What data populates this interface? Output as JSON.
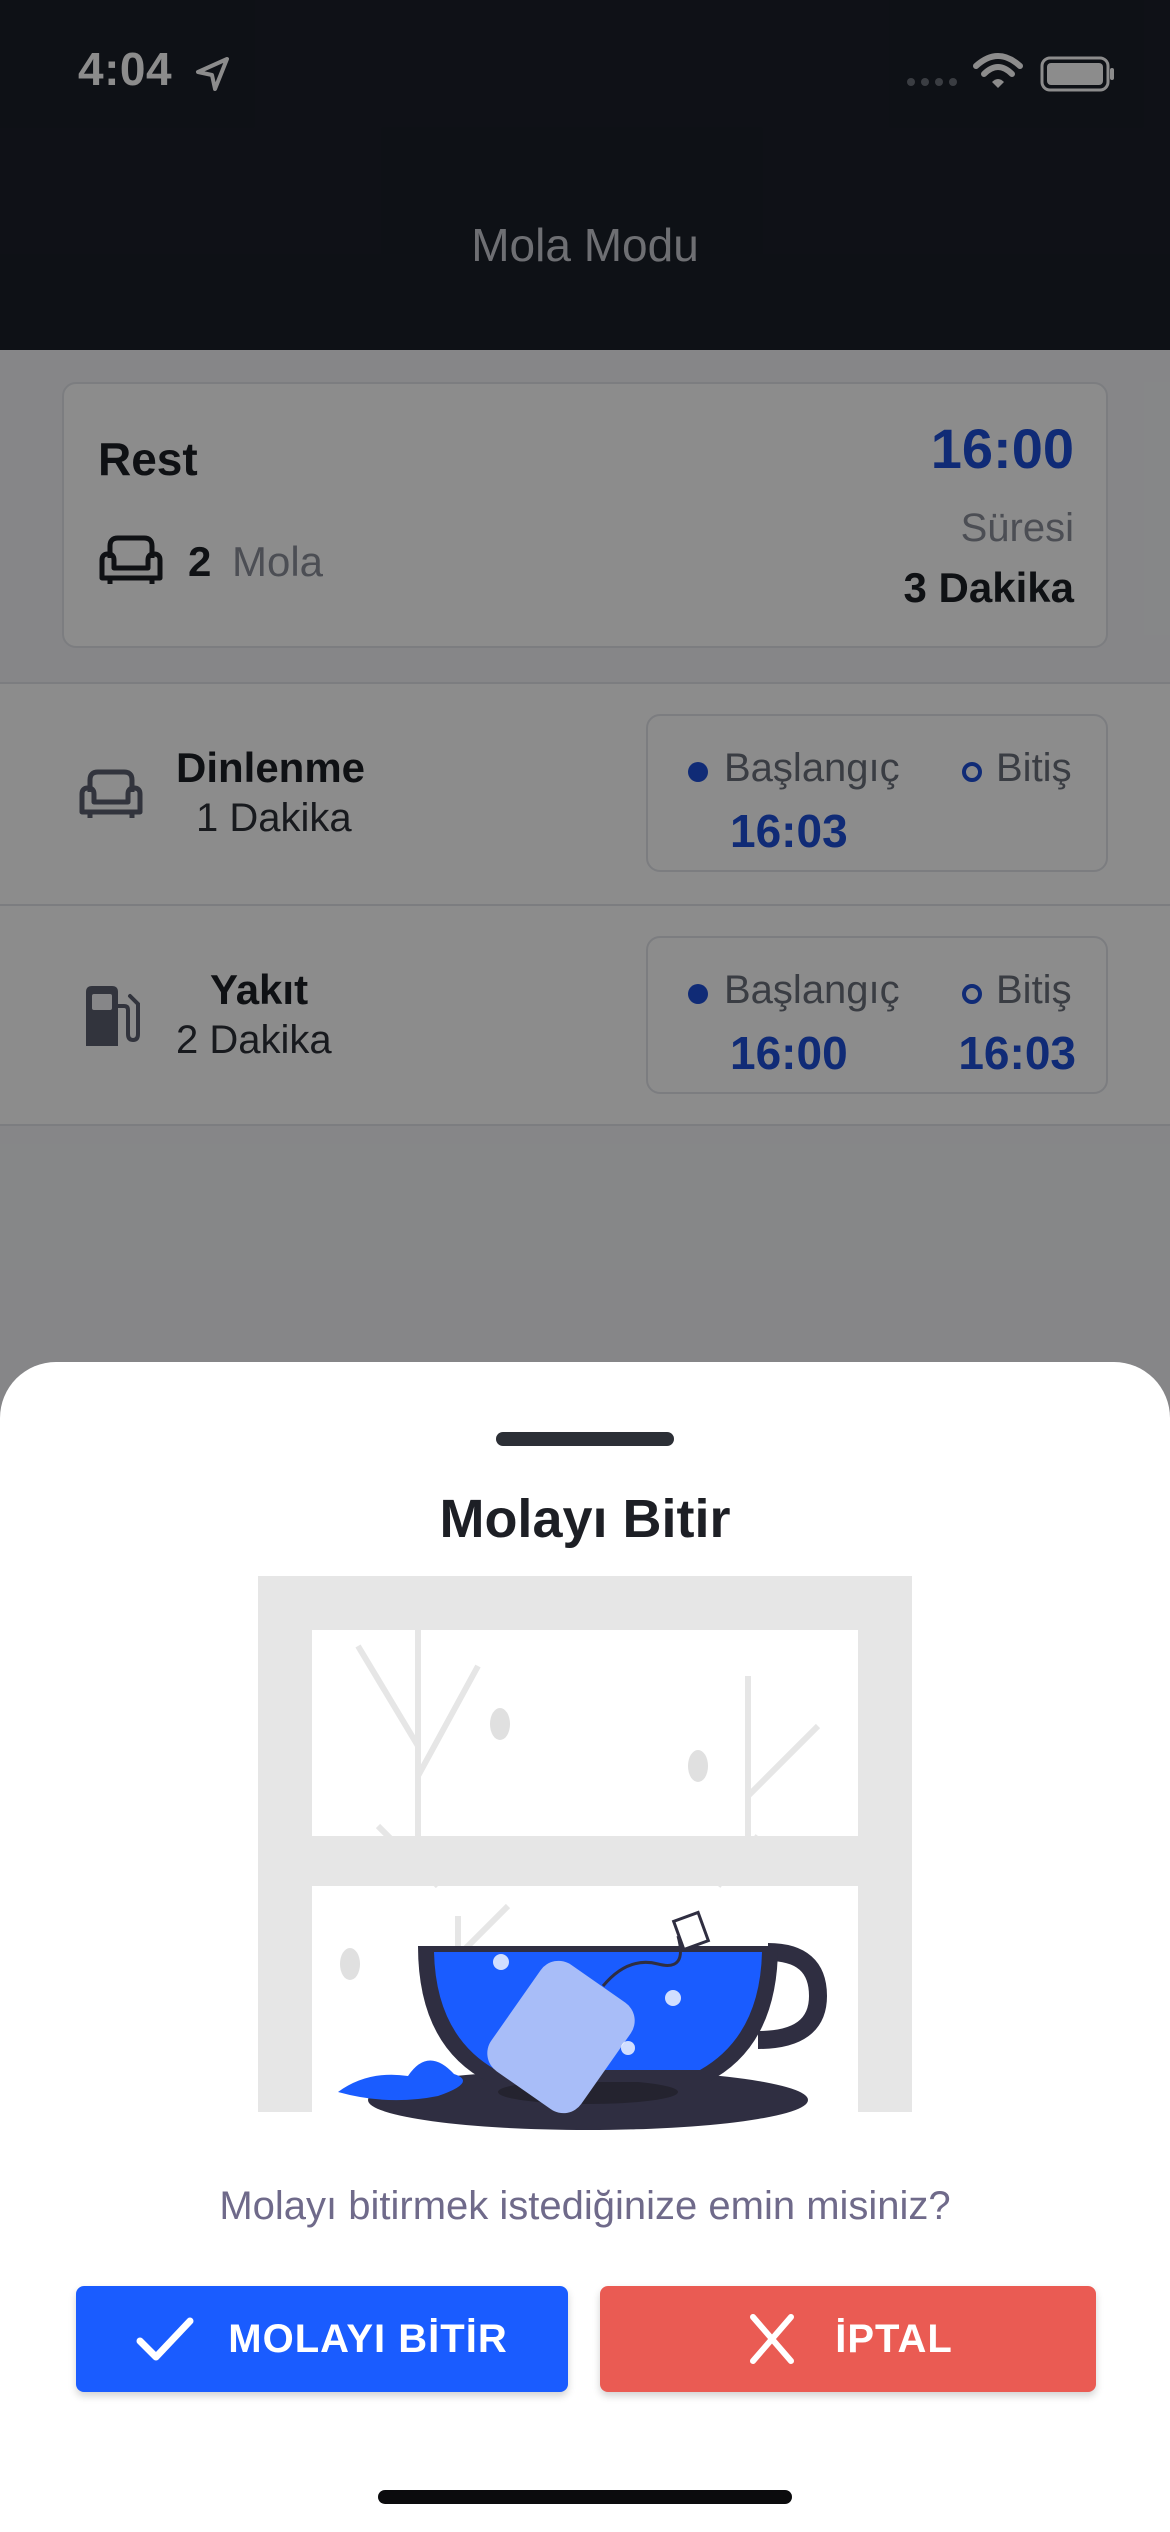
{
  "status_bar": {
    "time": "4:04",
    "icons": [
      "location-arrow-icon",
      "cellular-signal-icon",
      "wifi-icon",
      "battery-icon"
    ]
  },
  "header": {
    "title": "Mola Modu"
  },
  "summary": {
    "name": "Rest",
    "time": "16:00",
    "mola_count": "2",
    "mola_label": "Mola",
    "duration_label": "Süresi",
    "duration_value": "3 Dakika"
  },
  "breaks": [
    {
      "icon": "sofa-icon",
      "name": "Dinlenme",
      "duration": "1 Dakika",
      "start_label": "Başlangıç",
      "end_label": "Bitiş",
      "start": "16:03",
      "end": ""
    },
    {
      "icon": "fuel-pump-icon",
      "name": "Yakıt",
      "duration": "2 Dakika",
      "start_label": "Başlangıç",
      "end_label": "Bitiş",
      "start": "16:00",
      "end": "16:03"
    }
  ],
  "sheet": {
    "title": "Molayı Bitir",
    "illustration": "tea-cup-illustration",
    "message": "Molayı bitirmek istediğinize emin misiniz?",
    "confirm_label": "MOLAYI BİTİR",
    "cancel_label": "İPTAL"
  },
  "colors": {
    "header_bg": "#1b1f29",
    "accent_blue": "#1e4fd8",
    "button_blue": "#1a5cff",
    "button_red": "#ea5b53"
  }
}
